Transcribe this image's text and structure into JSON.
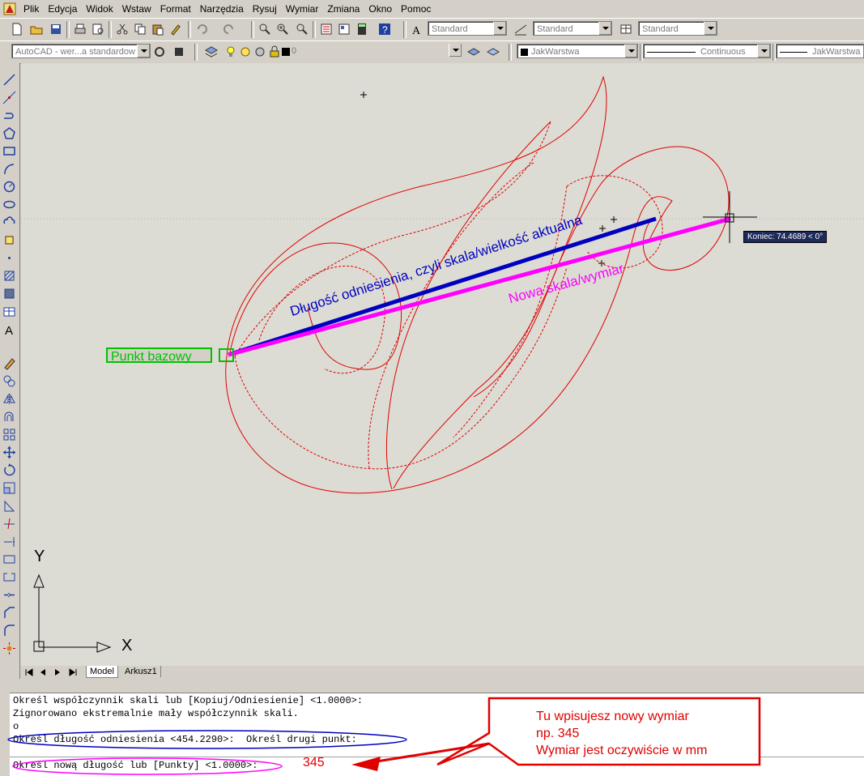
{
  "menubar": {
    "items": [
      "Plik",
      "Edycja",
      "Widok",
      "Wstaw",
      "Format",
      "Narzędzia",
      "Rysuj",
      "Wymiar",
      "Zmiana",
      "Okno",
      "Pomoc"
    ]
  },
  "toolbar1": {
    "text_style": "Standard",
    "dim_style": "Standard",
    "table_style": "Standard"
  },
  "toolbar2": {
    "workspace": "AutoCAD - wer...a standardow",
    "layer": "0",
    "color": "JakWarstwa",
    "linetype": "Continuous",
    "lineweight": "JakWarstwa"
  },
  "canvas": {
    "label_reference": "Długość odniesienia, czyli skala/wielkość aktualna",
    "label_new": "Nowa skala/wymiar",
    "label_base": "Punkt bazowy",
    "tooltip": "Koniec: 74.4689 < 0°",
    "ucs_y": "Y",
    "ucs_x": "X"
  },
  "tabs": [
    "Model",
    "Arkusz1"
  ],
  "command": {
    "lines": [
      "Określ współczynnik skali lub [Kopiuj/Odniesienie] <1.0000>:",
      "Zignorowano ekstremalnie mały współczynnik skali.",
      "o",
      "Określ długość odniesienia <454.2290>:  Określ drugi punkt:",
      "Określ nową długość lub [Punkty] <1.0000>:"
    ],
    "typed_value": "345"
  },
  "callout": {
    "line1": "Tu wpisujesz nowy wymiar",
    "line2": "np. 345",
    "line3": "Wymiar jest oczywiście w mm"
  },
  "colors": {
    "reference_line": "#0000c0",
    "new_line": "#ff00ff",
    "drawing": "#e00000",
    "base_point": "#00c000"
  }
}
